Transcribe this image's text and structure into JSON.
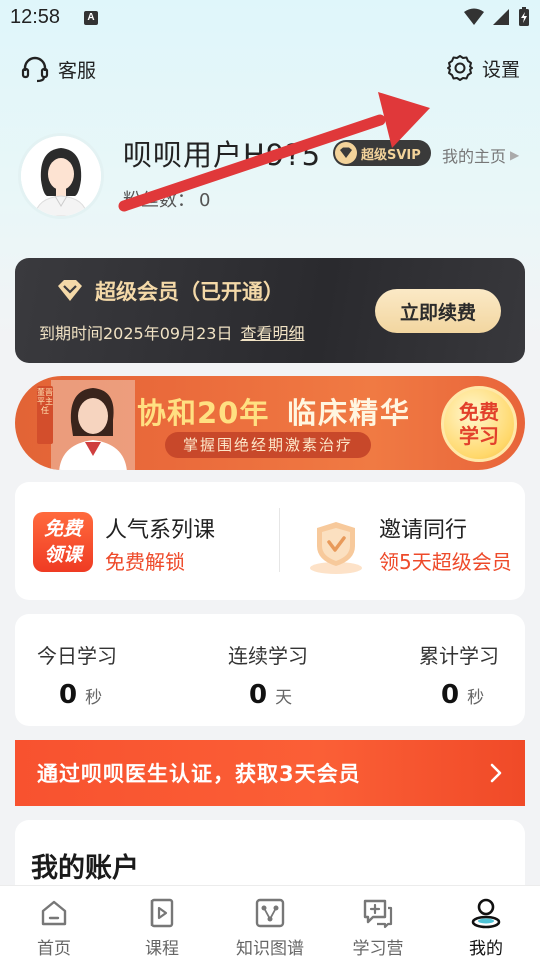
{
  "status_bar": {
    "time": "12:58",
    "app_badge": "A"
  },
  "top_actions": {
    "customer_service": "客服",
    "settings": "设置"
  },
  "profile": {
    "username": "呗呗用户H9?5",
    "svip_label": "超级SVIP",
    "homepage_link": "我的主页",
    "fans_label": "粉丝数：",
    "fans_count": "0"
  },
  "vip_card": {
    "title": "超级会员（已开通）",
    "expire_text": "到期时间2025年09月23日",
    "detail_link": "查看明细",
    "renew_button": "立即续费"
  },
  "banner": {
    "title_part1": "协和20年",
    "title_part2": "临床精华",
    "subtitle": "掌握围绝经期激素治疗",
    "badge_line1": "免费",
    "badge_line2": "学习",
    "doctor_tag": "董晋平主任"
  },
  "features": [
    {
      "icon_text_line1": "免费",
      "icon_text_line2": "领课",
      "title": "人气系列课",
      "subtitle": "免费解锁"
    },
    {
      "title": "邀请同行",
      "subtitle": "领5天超级会员"
    }
  ],
  "stats": [
    {
      "label": "今日学习",
      "value": "0",
      "unit": "秒"
    },
    {
      "label": "连续学习",
      "value": "0",
      "unit": "天"
    },
    {
      "label": "累计学习",
      "value": "0",
      "unit": "秒"
    }
  ],
  "cert_bar": {
    "text": "通过呗呗医生认证，获取3天会员"
  },
  "account": {
    "title": "我的账户"
  },
  "tabs": [
    {
      "label": "首页",
      "icon": "home-icon"
    },
    {
      "label": "课程",
      "icon": "course-icon"
    },
    {
      "label": "知识图谱",
      "icon": "knowledge-graph-icon"
    },
    {
      "label": "学习营",
      "icon": "study-camp-icon"
    },
    {
      "label": "我的",
      "icon": "profile-icon",
      "active": true
    }
  ],
  "colors": {
    "accent_red": "#f8522f",
    "gold": "#f4d9a8",
    "annotation_arrow": "#e0383a"
  }
}
